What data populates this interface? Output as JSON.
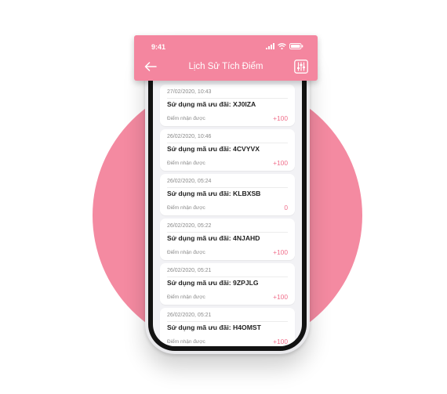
{
  "status_bar": {
    "time": "9:41"
  },
  "header": {
    "title": "Lịch Sử Tích Điểm"
  },
  "history": [
    {
      "date": "27/02/2020, 10:43",
      "title": "Sử dụng mã ưu đãi: XJ0IZA",
      "label": "Điểm nhận được",
      "points": "+100"
    },
    {
      "date": "26/02/2020, 10:46",
      "title": "Sử dụng mã ưu đãi: 4CVYVX",
      "label": "Điểm nhận được",
      "points": "+100"
    },
    {
      "date": "26/02/2020, 05:24",
      "title": "Sử dụng mã ưu đãi: KLBXSB",
      "label": "Điểm nhận được",
      "points": "0"
    },
    {
      "date": "26/02/2020, 05:22",
      "title": "Sử dụng mã ưu đãi: 4NJAHD",
      "label": "Điểm nhận được",
      "points": "+100"
    },
    {
      "date": "26/02/2020, 05:21",
      "title": "Sử dụng mã ưu đãi: 9ZPJLG",
      "label": "Điểm nhận được",
      "points": "+100"
    },
    {
      "date": "26/02/2020, 05:21",
      "title": "Sử dụng mã ưu đãi: H4OMST",
      "label": "Điểm nhận được",
      "points": "+100"
    }
  ],
  "colors": {
    "accent": "#f4869f",
    "background_circle": "#f48aa1",
    "points": "#f06f8b"
  },
  "icons": {
    "back": "arrow-left-icon",
    "filter": "sliders-icon",
    "signal": "signal-icon",
    "wifi": "wifi-icon",
    "battery": "battery-icon"
  }
}
